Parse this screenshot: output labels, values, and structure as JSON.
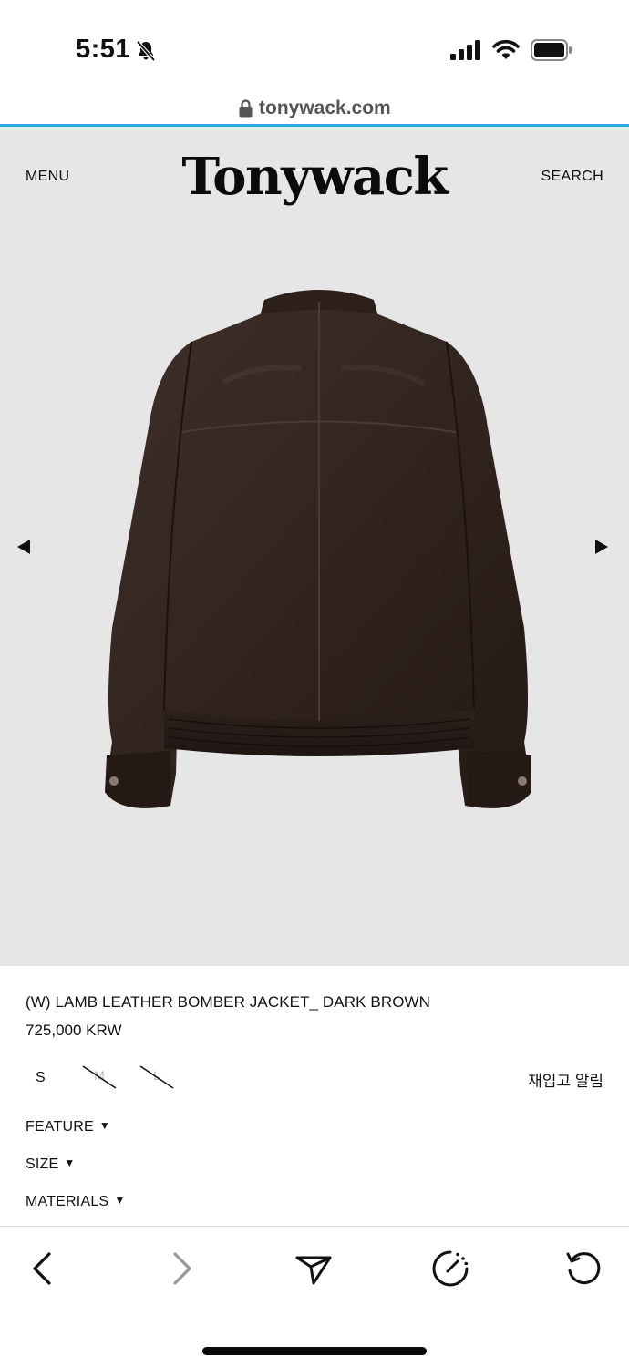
{
  "status_bar": {
    "time": "5:51",
    "icons": [
      "bell-slash-icon",
      "cellular-signal-icon",
      "wifi-icon",
      "battery-icon"
    ]
  },
  "browser": {
    "url": "tonywack.com",
    "accent": "#27a9e1"
  },
  "header": {
    "menu_label": "MENU",
    "logo_text": "Tonywack",
    "search_label": "SEARCH"
  },
  "gallery": {
    "image_subject": "leather-bomber-jacket-back-view",
    "background": "#e6e6e6",
    "prev_icon": "triangle-left-icon",
    "next_icon": "triangle-right-icon"
  },
  "product": {
    "name": "(W) LAMB LEATHER BOMBER JACKET_ DARK BROWN",
    "price": "725,000 KRW",
    "sizes": [
      {
        "label": "S",
        "available": true
      },
      {
        "label": "M",
        "available": false
      },
      {
        "label": "L",
        "available": false
      }
    ],
    "restock_label": "재입고 알림",
    "sections": [
      {
        "label": "FEATURE",
        "caret": "▼"
      },
      {
        "label": "SIZE",
        "caret": "▼"
      },
      {
        "label": "MATERIALS",
        "caret": "▼"
      }
    ]
  },
  "toolbar": {
    "icons": [
      "back-icon",
      "forward-icon",
      "share-icon",
      "speedometer-icon",
      "reload-icon"
    ]
  }
}
